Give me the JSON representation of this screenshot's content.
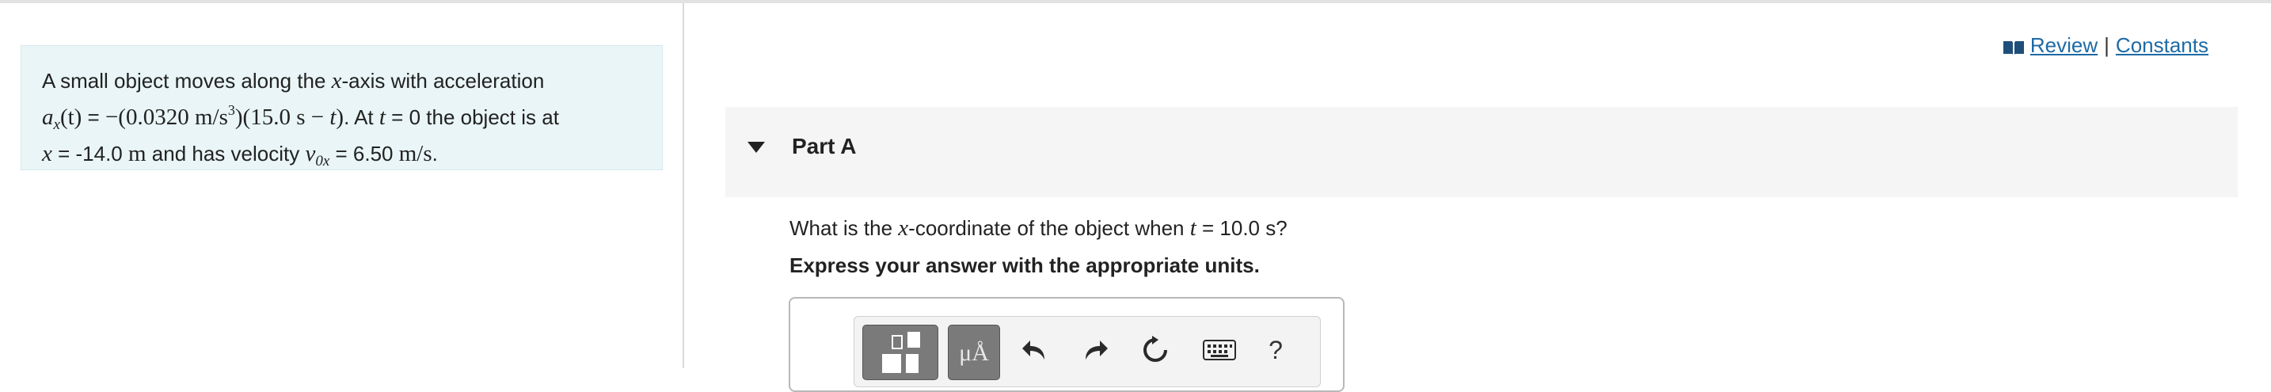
{
  "problem": {
    "line1_pre": "A small object moves along the ",
    "line1_var": "x",
    "line1_post": "-axis with acceleration",
    "accel_symbol": "a",
    "accel_sub": "x",
    "accel_arg": "(t)",
    "equals": " = ",
    "accel_coeff": "−(0.0320 m/s",
    "accel_exp": "3",
    "accel_factor": ")(15.0 s − ",
    "accel_t": "t",
    "accel_close": ")",
    "line2_mid": ". At ",
    "line2_t": "t",
    "line2_post": " = 0 the object is at",
    "line3_var": "x",
    "line3_val": " = -14.0 ",
    "line3_unit": "m",
    "line3_mid": " and has velocity ",
    "vel_symbol": "v",
    "vel_sub": "0x",
    "vel_val": " = 6.50 ",
    "vel_unit": "m/s",
    "line3_end": "."
  },
  "links": {
    "review": "Review",
    "separator": "|",
    "constants": "Constants"
  },
  "part": {
    "title": "Part A"
  },
  "question": {
    "pre": "What is the ",
    "var": "x",
    "mid": "-coordinate of the object when ",
    "t": "t",
    "post": " = 10.0 s?",
    "instruction": "Express your answer with the appropriate units."
  },
  "toolbar": {
    "units_label": "μÅ",
    "help_label": "?",
    "icons": [
      "templates-icon",
      "units-icon",
      "undo-icon",
      "redo-icon",
      "reset-icon",
      "keyboard-icon",
      "help-icon"
    ]
  },
  "colors": {
    "problem_bg": "#e9f5f6",
    "link": "#1d6aa5",
    "part_header_bg": "#f5f5f5",
    "toolbar_button": "#7a7a7a"
  }
}
